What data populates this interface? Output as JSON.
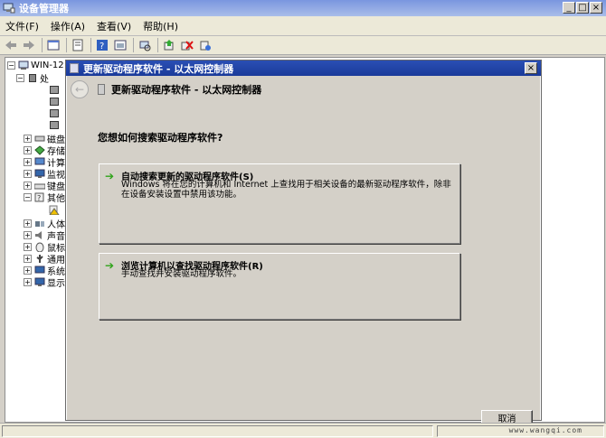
{
  "window": {
    "title": "设备管理器",
    "min": "_",
    "max": "□",
    "close": "×"
  },
  "menu": [
    "文件(F)",
    "操作(A)",
    "查看(V)",
    "帮助(H)"
  ],
  "tree": {
    "root": "WIN-12",
    "items": [
      "处",
      "磁盘",
      "存储",
      "计算",
      "监视",
      "键盘",
      "其他",
      "人体",
      "声音",
      "鼠标",
      "通用",
      "系统",
      "显示"
    ]
  },
  "dialog": {
    "title": "更新驱动程序软件 - 以太网控制器",
    "close": "×",
    "header": "更新驱动程序软件 - 以太网控制器",
    "question": "您想如何搜索驱动程序软件?",
    "options": [
      {
        "title": "自动搜索更新的驱动程序软件(S)",
        "desc": "Windows 将在您的计算机和 Internet 上查找用于相关设备的最新驱动程序软件，除非在设备安装设置中禁用该功能。"
      },
      {
        "title": "浏览计算机以查找驱动程序软件(R)",
        "desc": "手动查找并安装驱动程序软件。"
      }
    ],
    "cancel": "取消"
  },
  "status": {
    "watermark": "www.wangqi.com"
  }
}
